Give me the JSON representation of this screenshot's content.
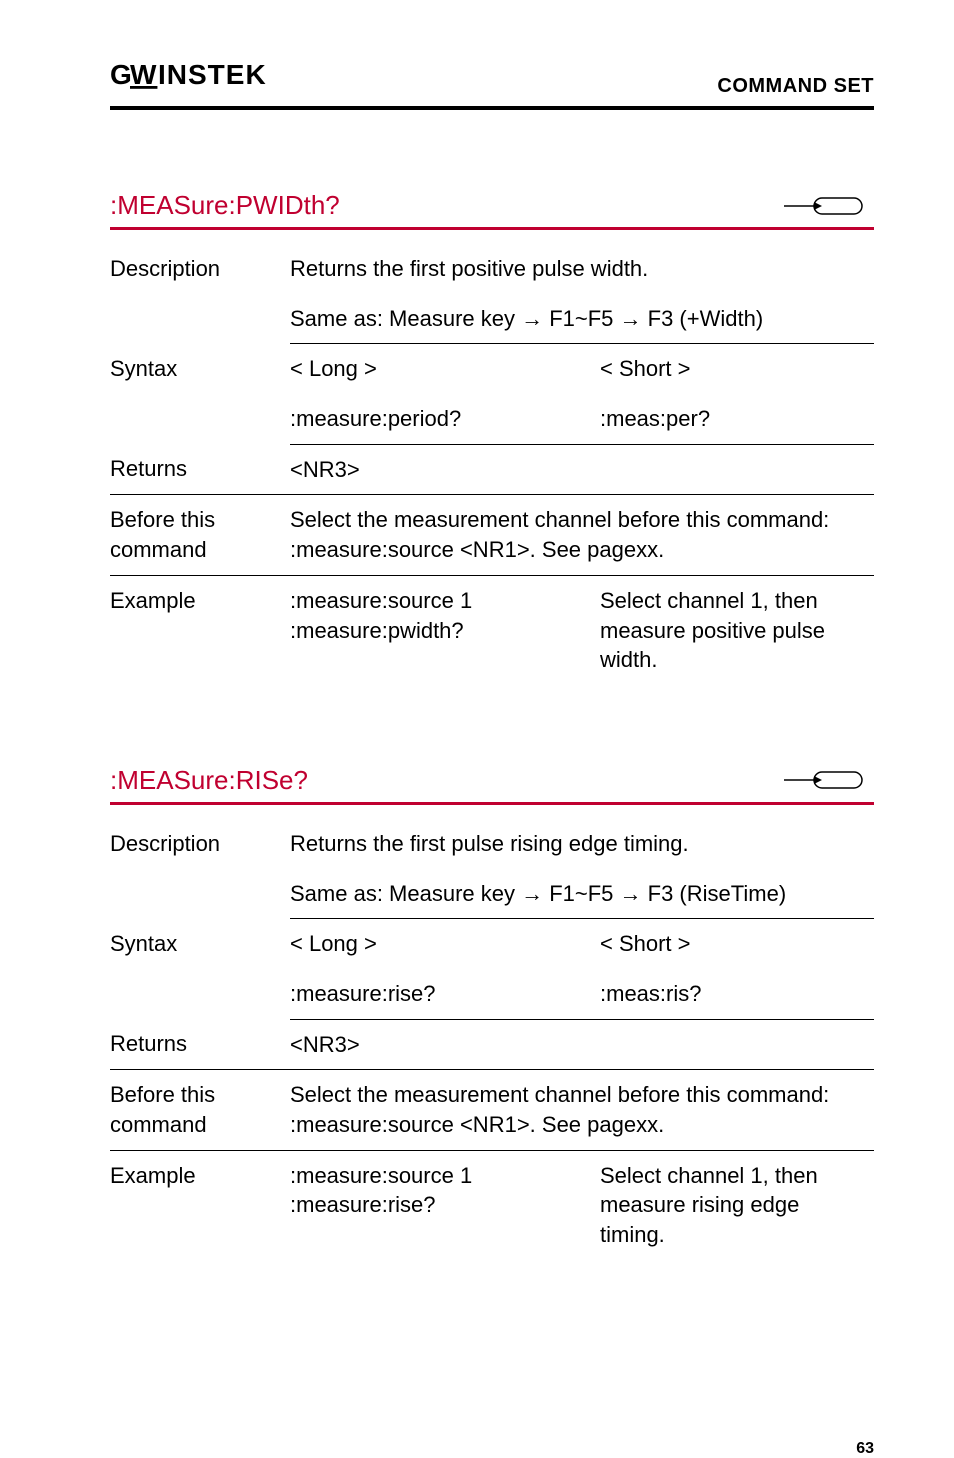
{
  "header": {
    "logo": "GWINSTEK",
    "section": "COMMAND SET"
  },
  "commands": [
    {
      "title": ":MEASure:PWIDth?",
      "rows": {
        "description_label": "Description",
        "description_line1": "Returns the first positive pulse width.",
        "description_line2": "Same as: Measure key → F1~F5 → F3 (+Width)",
        "syntax_label": "Syntax",
        "syntax_long_header": "< Long >",
        "syntax_short_header": "< Short >",
        "syntax_long": ":measure:period?",
        "syntax_short": ":meas:per?",
        "returns_label": "Returns",
        "returns_value": "<NR3>",
        "before_label": "Before this command",
        "before_value": "Select the measurement channel before this command: :measure:source <NR1>. See pagexx.",
        "example_label": "Example",
        "example_cmd1": ":measure:source 1",
        "example_cmd2": ":measure:pwidth?",
        "example_result": "Select channel 1, then measure positive pulse width."
      }
    },
    {
      "title": ":MEASure:RISe?",
      "rows": {
        "description_label": "Description",
        "description_line1": "Returns the first pulse rising edge timing.",
        "description_line2": "Same as: Measure key → F1~F5 → F3 (RiseTime)",
        "syntax_label": "Syntax",
        "syntax_long_header": "< Long >",
        "syntax_short_header": "< Short >",
        "syntax_long": ":measure:rise?",
        "syntax_short": ":meas:ris?",
        "returns_label": "Returns",
        "returns_value": "<NR3>",
        "before_label": "Before this command",
        "before_value": "Select the measurement channel before this command: :measure:source <NR1>. See pagexx.",
        "example_label": "Example",
        "example_cmd1": ":measure:source 1",
        "example_cmd2": ":measure:rise?",
        "example_result": "Select channel 1, then measure rising edge timing."
      }
    }
  ],
  "page_number": "63"
}
